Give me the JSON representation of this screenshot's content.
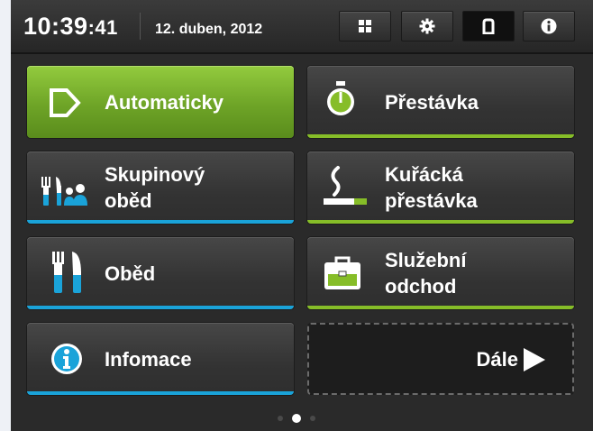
{
  "header": {
    "time_hm": "10:39",
    "time_s": ":41",
    "date": "12. duben, 2012",
    "buttons": [
      {
        "name": "grid-icon",
        "active": false
      },
      {
        "name": "gear-icon",
        "active": false
      },
      {
        "name": "door-icon",
        "active": true
      },
      {
        "name": "info-icon",
        "active": false
      }
    ]
  },
  "tiles": {
    "automaticky": {
      "line1": "Automaticky",
      "icon": "auto-arrow-icon",
      "accent": "#86bd28"
    },
    "prestavka": {
      "line1": "Přestávka",
      "icon": "stopwatch-icon",
      "accent": "#86bd28"
    },
    "skupinovy_obed": {
      "line1": "Skupinový",
      "line2": "oběd",
      "icon": "group-lunch-icon",
      "accent": "#1aa3d9"
    },
    "kuracka_prestavka": {
      "line1": "Kuřácká",
      "line2": "přestávka",
      "icon": "cigarette-icon",
      "accent": "#86bd28"
    },
    "obed": {
      "line1": "Oběd",
      "icon": "cutlery-icon",
      "accent": "#1aa3d9"
    },
    "sluzebni_odchod": {
      "line1": "Služební",
      "line2": "odchod",
      "icon": "briefcase-icon",
      "accent": "#86bd28"
    },
    "infomace": {
      "line1": "Infomace",
      "icon": "info-circle-icon",
      "accent": "#1aa3d9"
    },
    "dale": {
      "line1": "Dále",
      "icon": "play-arrow-icon"
    }
  },
  "pager": {
    "pages": 3,
    "current": 2
  }
}
